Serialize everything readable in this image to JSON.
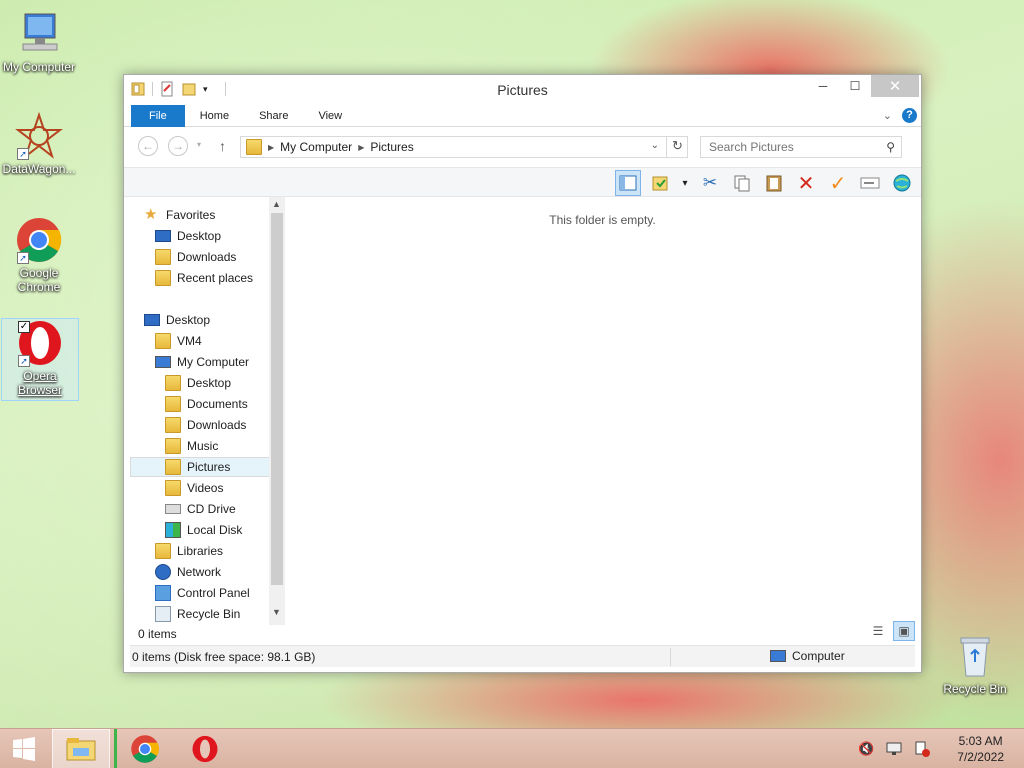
{
  "desktop": {
    "icons": [
      {
        "label": "My Computer"
      },
      {
        "label": "DataWagon..."
      },
      {
        "label": "Google Chrome"
      },
      {
        "label": "Opera Browser"
      },
      {
        "label": "Recycle Bin"
      }
    ]
  },
  "window": {
    "title": "Pictures",
    "controls": {
      "minimize": "─",
      "maximize": "☐",
      "close": "✕"
    },
    "tabs": [
      {
        "label": "File"
      },
      {
        "label": "Home"
      },
      {
        "label": "Share"
      },
      {
        "label": "View"
      }
    ],
    "address": {
      "crumbs": [
        "My Computer",
        "Pictures"
      ]
    },
    "search": {
      "placeholder": "Search Pictures"
    },
    "nav": {
      "items": [
        {
          "label": "Favorites"
        },
        {
          "label": "Desktop"
        },
        {
          "label": "Downloads"
        },
        {
          "label": "Recent places"
        },
        {
          "label": "Desktop"
        },
        {
          "label": "VM4"
        },
        {
          "label": "My Computer"
        },
        {
          "label": "Desktop"
        },
        {
          "label": "Documents"
        },
        {
          "label": "Downloads"
        },
        {
          "label": "Music"
        },
        {
          "label": "Pictures"
        },
        {
          "label": "Videos"
        },
        {
          "label": "CD Drive"
        },
        {
          "label": "Local Disk"
        },
        {
          "label": "Libraries"
        },
        {
          "label": "Network"
        },
        {
          "label": "Control Panel"
        },
        {
          "label": "Recycle Bin"
        }
      ]
    },
    "content": {
      "empty_message": "This folder is empty."
    },
    "item_count": "0 items",
    "status": {
      "left": "0 items (Disk free space: 98.1 GB)",
      "right": "Computer"
    }
  },
  "taskbar": {
    "clock": {
      "time": "5:03 AM",
      "date": "7/2/2022"
    }
  },
  "colors": {
    "accent": "#1979ca",
    "selection": "#cce4f7"
  }
}
